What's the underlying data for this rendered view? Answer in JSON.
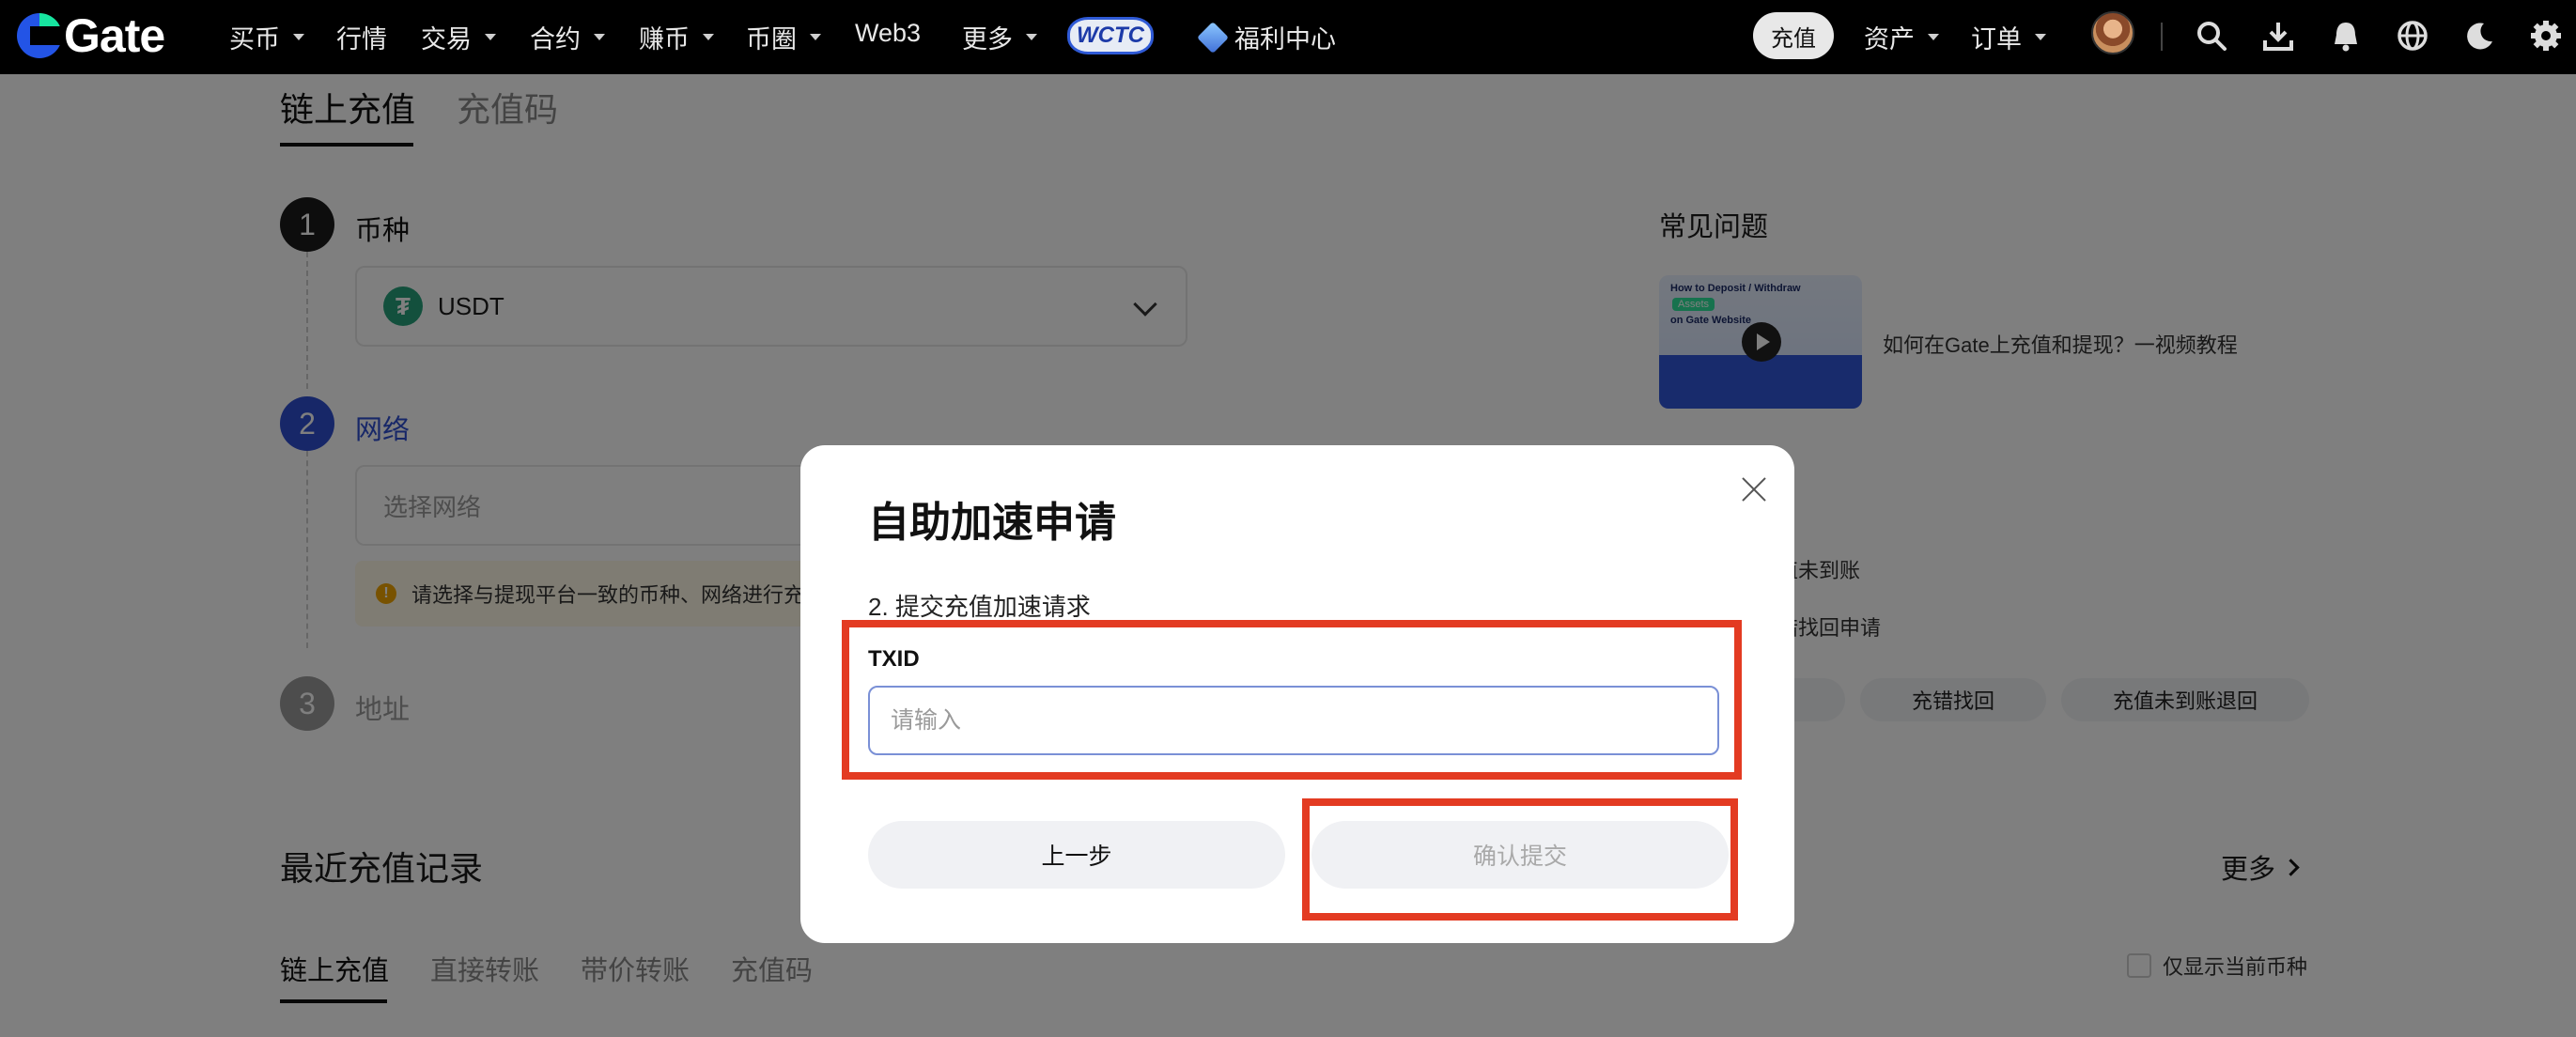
{
  "nav": {
    "brand": "Gate",
    "items": [
      {
        "label": "买币",
        "caret": true
      },
      {
        "label": "行情",
        "caret": false
      },
      {
        "label": "交易",
        "caret": true
      },
      {
        "label": "合约",
        "caret": true
      },
      {
        "label": "赚币",
        "caret": true
      },
      {
        "label": "币圈",
        "caret": true
      },
      {
        "label": "Web3",
        "caret": false
      },
      {
        "label": "更多",
        "caret": true
      }
    ],
    "wctc_badge": "WCTC",
    "welfare_label": "福利中心",
    "deposit_label": "充值",
    "assets_label": "资产",
    "orders_label": "订单"
  },
  "page": {
    "tabs": [
      "链上充值",
      "充值码"
    ],
    "steps": [
      {
        "num": "1",
        "label": "币种"
      },
      {
        "num": "2",
        "label": "网络"
      },
      {
        "num": "3",
        "label": "地址"
      }
    ],
    "coin": {
      "symbol": "USDT",
      "icon": "tether-icon"
    },
    "network_placeholder": "选择网络",
    "warning_text": "请选择与提现平台一致的币种、网络进行充值",
    "faq": {
      "title": "常见问题",
      "video_thumb": {
        "line1": "How to Deposit / Withdraw",
        "line2": "Assets",
        "line3": "on Gate Website"
      },
      "video_link": "如何在Gate上充值和提现？一视频教程",
      "links_partial": [
        "充值未到账",
        "充错找回申请"
      ],
      "chips": [
        "充错找回",
        "充值未到账退回"
      ]
    },
    "recent": {
      "title": "最近充值记录",
      "more_label": "更多",
      "tabs": [
        "链上充值",
        "直接转账",
        "带价转账",
        "充值码"
      ],
      "only_current_label": "仅显示当前币种"
    }
  },
  "modal": {
    "title": "自助加速申请",
    "step_text": "2. 提交充值加速请求",
    "field_label": "TXID",
    "input_placeholder": "请输入",
    "input_value": "",
    "prev_label": "上一步",
    "confirm_label": "确认提交",
    "confirm_disabled": true
  },
  "colors": {
    "nav_bg": "#000000",
    "step_active": "#2f4fd0",
    "step_done": "#1a1a1a",
    "highlight": "#e33b22",
    "overlay": "rgba(0,0,0,0.5)"
  }
}
